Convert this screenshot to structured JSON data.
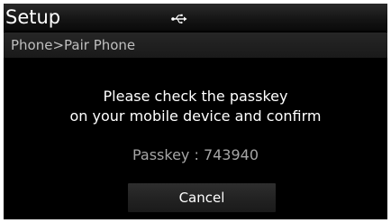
{
  "header": {
    "title": "Setup",
    "status_icon": "usb-icon"
  },
  "breadcrumb": {
    "path": "Phone>Pair Phone"
  },
  "dialog": {
    "message_line1": "Please check the passkey",
    "message_line2": "on your mobile device and confirm",
    "passkey": "Passkey : 743940",
    "cancel_label": "Cancel"
  },
  "colors": {
    "background": "#000000",
    "text_primary": "#ffffff",
    "text_secondary": "#bfbfbf",
    "passkey_text": "#a6a6a6"
  }
}
